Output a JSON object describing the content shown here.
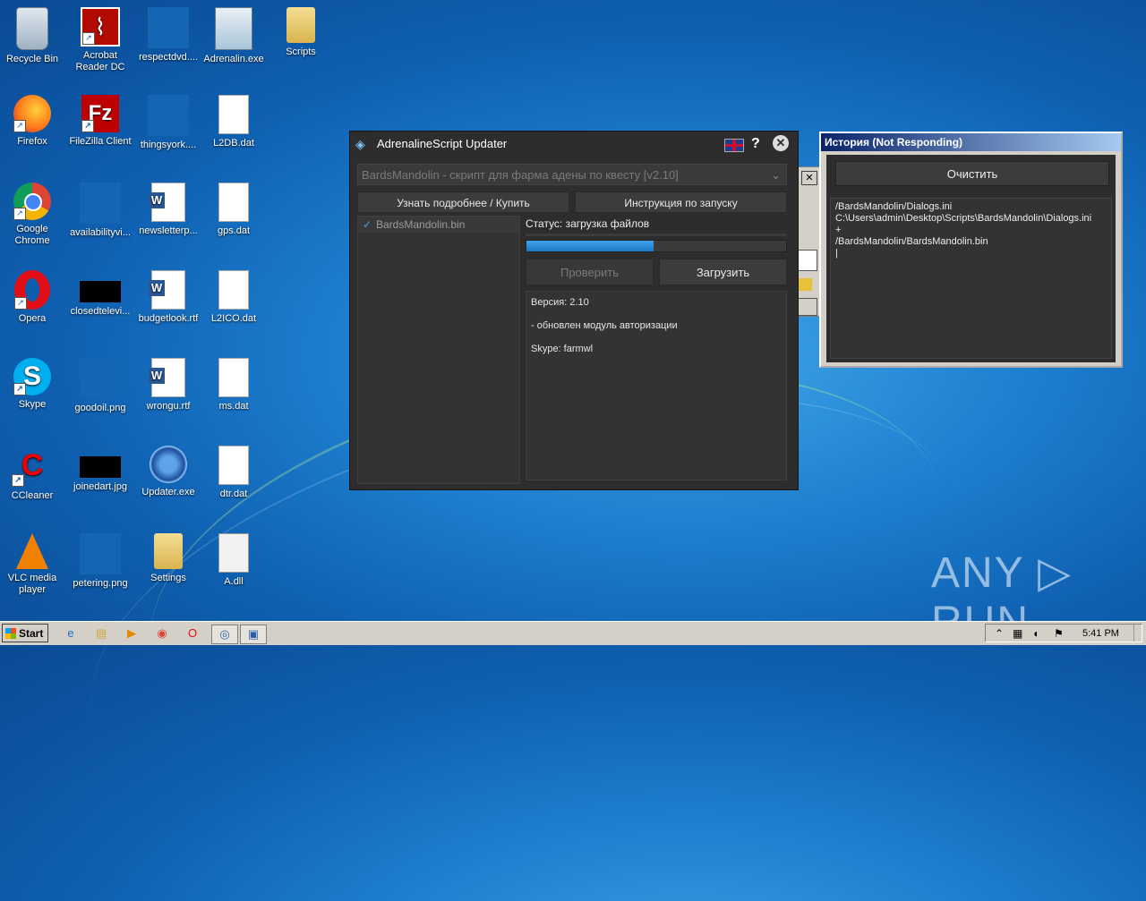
{
  "desktop": {
    "icons": [
      {
        "label": "Recycle Bin",
        "icon": "recycle-bin-icon"
      },
      {
        "label": "Acrobat Reader DC",
        "icon": "acrobat-icon"
      },
      {
        "label": "respectdvd....",
        "icon": "file-icon"
      },
      {
        "label": "Adrenalin.exe",
        "icon": "app-icon"
      },
      {
        "label": "Scripts",
        "icon": "folder-icon"
      },
      {
        "label": "Firefox",
        "icon": "firefox-icon"
      },
      {
        "label": "FileZilla Client",
        "icon": "filezilla-icon"
      },
      {
        "label": "thingsyork....",
        "icon": "file-icon"
      },
      {
        "label": "L2DB.dat",
        "icon": "file-icon"
      },
      {
        "label": "Google Chrome",
        "icon": "chrome-icon"
      },
      {
        "label": "availabilityvi...",
        "icon": "file-icon"
      },
      {
        "label": "newsletterp...",
        "icon": "word-icon"
      },
      {
        "label": "gps.dat",
        "icon": "file-icon"
      },
      {
        "label": "Opera",
        "icon": "opera-icon"
      },
      {
        "label": "closedtelevi...",
        "icon": "image-icon"
      },
      {
        "label": "budgetlook.rtf",
        "icon": "word-icon"
      },
      {
        "label": "L2ICO.dat",
        "icon": "file-icon"
      },
      {
        "label": "Skype",
        "icon": "skype-icon"
      },
      {
        "label": "goodoil.png",
        "icon": "file-icon"
      },
      {
        "label": "wrongu.rtf",
        "icon": "word-icon"
      },
      {
        "label": "ms.dat",
        "icon": "file-icon"
      },
      {
        "label": "CCleaner",
        "icon": "ccleaner-icon"
      },
      {
        "label": "joinedart.jpg",
        "icon": "image-icon"
      },
      {
        "label": "Updater.exe",
        "icon": "updater-icon"
      },
      {
        "label": "dtr.dat",
        "icon": "file-icon"
      },
      {
        "label": "VLC media player",
        "icon": "vlc-icon"
      },
      {
        "label": "petering.png",
        "icon": "file-icon"
      },
      {
        "label": "Settings",
        "icon": "folder-icon"
      },
      {
        "label": "A.dll",
        "icon": "dll-icon"
      }
    ]
  },
  "updater": {
    "title": "AdrenalineScript Updater",
    "help": "?",
    "close": "✕",
    "script_combo": "BardsMandolin - скрипт для фарма адены по квесту [v2.10]",
    "btn_more": "Узнать подробнее / Купить",
    "btn_instructions": "Инструкция по запуску",
    "files": [
      "BardsMandolin.bin"
    ],
    "status": "Статус: загрузка файлов",
    "progress": 0.49,
    "btn_check": "Проверить",
    "btn_download": "Загрузить",
    "notes": [
      "Версия: 2.10",
      "- обновлен модуль авторизации",
      "Skype: farmwl"
    ]
  },
  "history": {
    "title": "История (Not Responding)",
    "clear_btn": "Очистить",
    "log": "/BardsMandolin/Dialogs.ini\nC:\\Users\\admin\\Desktop\\Scripts\\BardsMandolin\\Dialogs.ini\n+\n/BardsMandolin/BardsMandolin.bin\n|"
  },
  "watermark": "ANY ▷ RUN",
  "taskbar": {
    "start_label": "Start",
    "clock": "5:41 PM"
  }
}
